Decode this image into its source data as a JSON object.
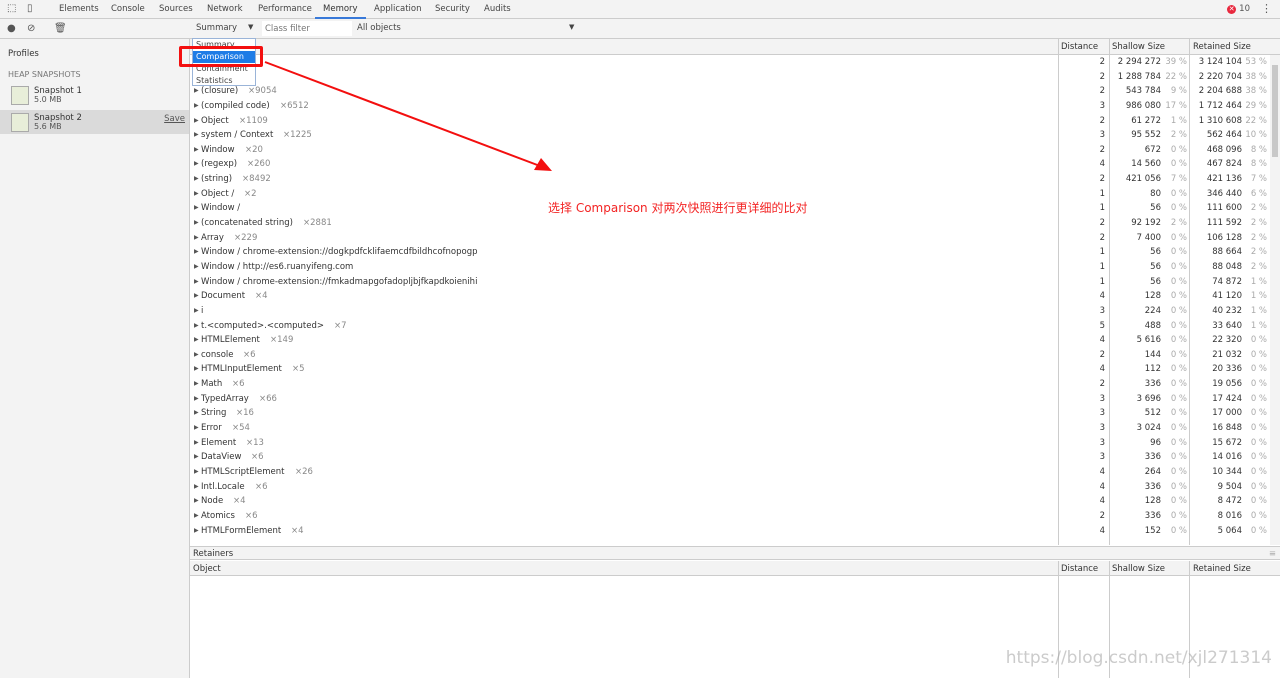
{
  "devtools_tabs": [
    "Elements",
    "Console",
    "Sources",
    "Network",
    "Performance",
    "Memory",
    "Application",
    "Security",
    "Audits"
  ],
  "active_tab": "Memory",
  "error_count": "10",
  "toolbar": {
    "view_select": "Summary",
    "class_filter_placeholder": "Class filter",
    "objects_select": "All objects"
  },
  "dropdown_options": [
    "Summary",
    "Comparison",
    "Containment",
    "Statistics"
  ],
  "dropdown_highlighted": "Comparison",
  "sidebar": {
    "title": "Profiles",
    "section": "HEAP SNAPSHOTS",
    "snapshots": [
      {
        "name": "Snapshot 1",
        "size": "5.0 MB"
      },
      {
        "name": "Snapshot 2",
        "size": "5.6 MB",
        "save": "Save"
      }
    ]
  },
  "columns": {
    "distance": "Distance",
    "shallow": "Shallow Size",
    "retained": "Retained Size"
  },
  "rows": [
    {
      "name": "",
      "count": "",
      "distance": "2",
      "shallow": "2 294 272",
      "shallow_pct": "39 %",
      "retained": "3 124 104",
      "retained_pct": "53 %"
    },
    {
      "name": "",
      "count": "",
      "distance": "2",
      "shallow": "1 288 784",
      "shallow_pct": "22 %",
      "retained": "2 220 704",
      "retained_pct": "38 %"
    },
    {
      "name": "(closure)",
      "count": "×9054",
      "distance": "2",
      "shallow": "543 784",
      "shallow_pct": "9 %",
      "retained": "2 204 688",
      "retained_pct": "38 %"
    },
    {
      "name": "(compiled code)",
      "count": "×6512",
      "distance": "3",
      "shallow": "986 080",
      "shallow_pct": "17 %",
      "retained": "1 712 464",
      "retained_pct": "29 %"
    },
    {
      "name": "Object",
      "count": "×1109",
      "distance": "2",
      "shallow": "61 272",
      "shallow_pct": "1 %",
      "retained": "1 310 608",
      "retained_pct": "22 %"
    },
    {
      "name": "system / Context",
      "count": "×1225",
      "distance": "3",
      "shallow": "95 552",
      "shallow_pct": "2 %",
      "retained": "562 464",
      "retained_pct": "10 %"
    },
    {
      "name": "Window",
      "count": "×20",
      "distance": "2",
      "shallow": "672",
      "shallow_pct": "0 %",
      "retained": "468 096",
      "retained_pct": "8 %"
    },
    {
      "name": "(regexp)",
      "count": "×260",
      "distance": "4",
      "shallow": "14 560",
      "shallow_pct": "0 %",
      "retained": "467 824",
      "retained_pct": "8 %"
    },
    {
      "name": "(string)",
      "count": "×8492",
      "distance": "2",
      "shallow": "421 056",
      "shallow_pct": "7 %",
      "retained": "421 136",
      "retained_pct": "7 %"
    },
    {
      "name": "Object /",
      "count": "×2",
      "distance": "1",
      "shallow": "80",
      "shallow_pct": "0 %",
      "retained": "346 440",
      "retained_pct": "6 %"
    },
    {
      "name": "Window /",
      "count": "",
      "distance": "1",
      "shallow": "56",
      "shallow_pct": "0 %",
      "retained": "111 600",
      "retained_pct": "2 %"
    },
    {
      "name": "(concatenated string)",
      "count": "×2881",
      "distance": "2",
      "shallow": "92 192",
      "shallow_pct": "2 %",
      "retained": "111 592",
      "retained_pct": "2 %"
    },
    {
      "name": "Array",
      "count": "×229",
      "distance": "2",
      "shallow": "7 400",
      "shallow_pct": "0 %",
      "retained": "106 128",
      "retained_pct": "2 %"
    },
    {
      "name": "Window / chrome-extension://dogkpdfcklifaemcdfbildhcofnopogp",
      "count": "",
      "distance": "1",
      "shallow": "56",
      "shallow_pct": "0 %",
      "retained": "88 664",
      "retained_pct": "2 %"
    },
    {
      "name": "Window / http://es6.ruanyifeng.com",
      "count": "",
      "distance": "1",
      "shallow": "56",
      "shallow_pct": "0 %",
      "retained": "88 048",
      "retained_pct": "2 %"
    },
    {
      "name": "Window / chrome-extension://fmkadmapgofadopljbjfkapdkoienihi",
      "count": "",
      "distance": "1",
      "shallow": "56",
      "shallow_pct": "0 %",
      "retained": "74 872",
      "retained_pct": "1 %"
    },
    {
      "name": "Document",
      "count": "×4",
      "distance": "4",
      "shallow": "128",
      "shallow_pct": "0 %",
      "retained": "41 120",
      "retained_pct": "1 %"
    },
    {
      "name": "i",
      "count": "",
      "distance": "3",
      "shallow": "224",
      "shallow_pct": "0 %",
      "retained": "40 232",
      "retained_pct": "1 %"
    },
    {
      "name": "t.<computed>.<computed>",
      "count": "×7",
      "distance": "5",
      "shallow": "488",
      "shallow_pct": "0 %",
      "retained": "33 640",
      "retained_pct": "1 %"
    },
    {
      "name": "HTMLElement",
      "count": "×149",
      "distance": "4",
      "shallow": "5 616",
      "shallow_pct": "0 %",
      "retained": "22 320",
      "retained_pct": "0 %"
    },
    {
      "name": "console",
      "count": "×6",
      "distance": "2",
      "shallow": "144",
      "shallow_pct": "0 %",
      "retained": "21 032",
      "retained_pct": "0 %"
    },
    {
      "name": "HTMLInputElement",
      "count": "×5",
      "distance": "4",
      "shallow": "112",
      "shallow_pct": "0 %",
      "retained": "20 336",
      "retained_pct": "0 %"
    },
    {
      "name": "Math",
      "count": "×6",
      "distance": "2",
      "shallow": "336",
      "shallow_pct": "0 %",
      "retained": "19 056",
      "retained_pct": "0 %"
    },
    {
      "name": "TypedArray",
      "count": "×66",
      "distance": "3",
      "shallow": "3 696",
      "shallow_pct": "0 %",
      "retained": "17 424",
      "retained_pct": "0 %"
    },
    {
      "name": "String",
      "count": "×16",
      "distance": "3",
      "shallow": "512",
      "shallow_pct": "0 %",
      "retained": "17 000",
      "retained_pct": "0 %"
    },
    {
      "name": "Error",
      "count": "×54",
      "distance": "3",
      "shallow": "3 024",
      "shallow_pct": "0 %",
      "retained": "16 848",
      "retained_pct": "0 %"
    },
    {
      "name": "Element",
      "count": "×13",
      "distance": "3",
      "shallow": "96",
      "shallow_pct": "0 %",
      "retained": "15 672",
      "retained_pct": "0 %"
    },
    {
      "name": "DataView",
      "count": "×6",
      "distance": "3",
      "shallow": "336",
      "shallow_pct": "0 %",
      "retained": "14 016",
      "retained_pct": "0 %"
    },
    {
      "name": "HTMLScriptElement",
      "count": "×26",
      "distance": "4",
      "shallow": "264",
      "shallow_pct": "0 %",
      "retained": "10 344",
      "retained_pct": "0 %"
    },
    {
      "name": "Intl.Locale",
      "count": "×6",
      "distance": "4",
      "shallow": "336",
      "shallow_pct": "0 %",
      "retained": "9 504",
      "retained_pct": "0 %"
    },
    {
      "name": "Node",
      "count": "×4",
      "distance": "4",
      "shallow": "128",
      "shallow_pct": "0 %",
      "retained": "8 472",
      "retained_pct": "0 %"
    },
    {
      "name": "Atomics",
      "count": "×6",
      "distance": "2",
      "shallow": "336",
      "shallow_pct": "0 %",
      "retained": "8 016",
      "retained_pct": "0 %"
    },
    {
      "name": "HTMLFormElement",
      "count": "×4",
      "distance": "4",
      "shallow": "152",
      "shallow_pct": "0 %",
      "retained": "5 064",
      "retained_pct": "0 %"
    }
  ],
  "retainers": {
    "title": "Retainers",
    "object": "Object",
    "distance": "Distance",
    "shallow": "Shallow Size",
    "retained": "Retained Size"
  },
  "annotation": "选择 Comparison 对两次快照进行更详细的比对",
  "watermark": "https://blog.csdn.net/xjl271314",
  "colors": {
    "annotation": "#f32424",
    "highlight": "#1e7ce6",
    "active_tab_underline": "#3879d9"
  }
}
